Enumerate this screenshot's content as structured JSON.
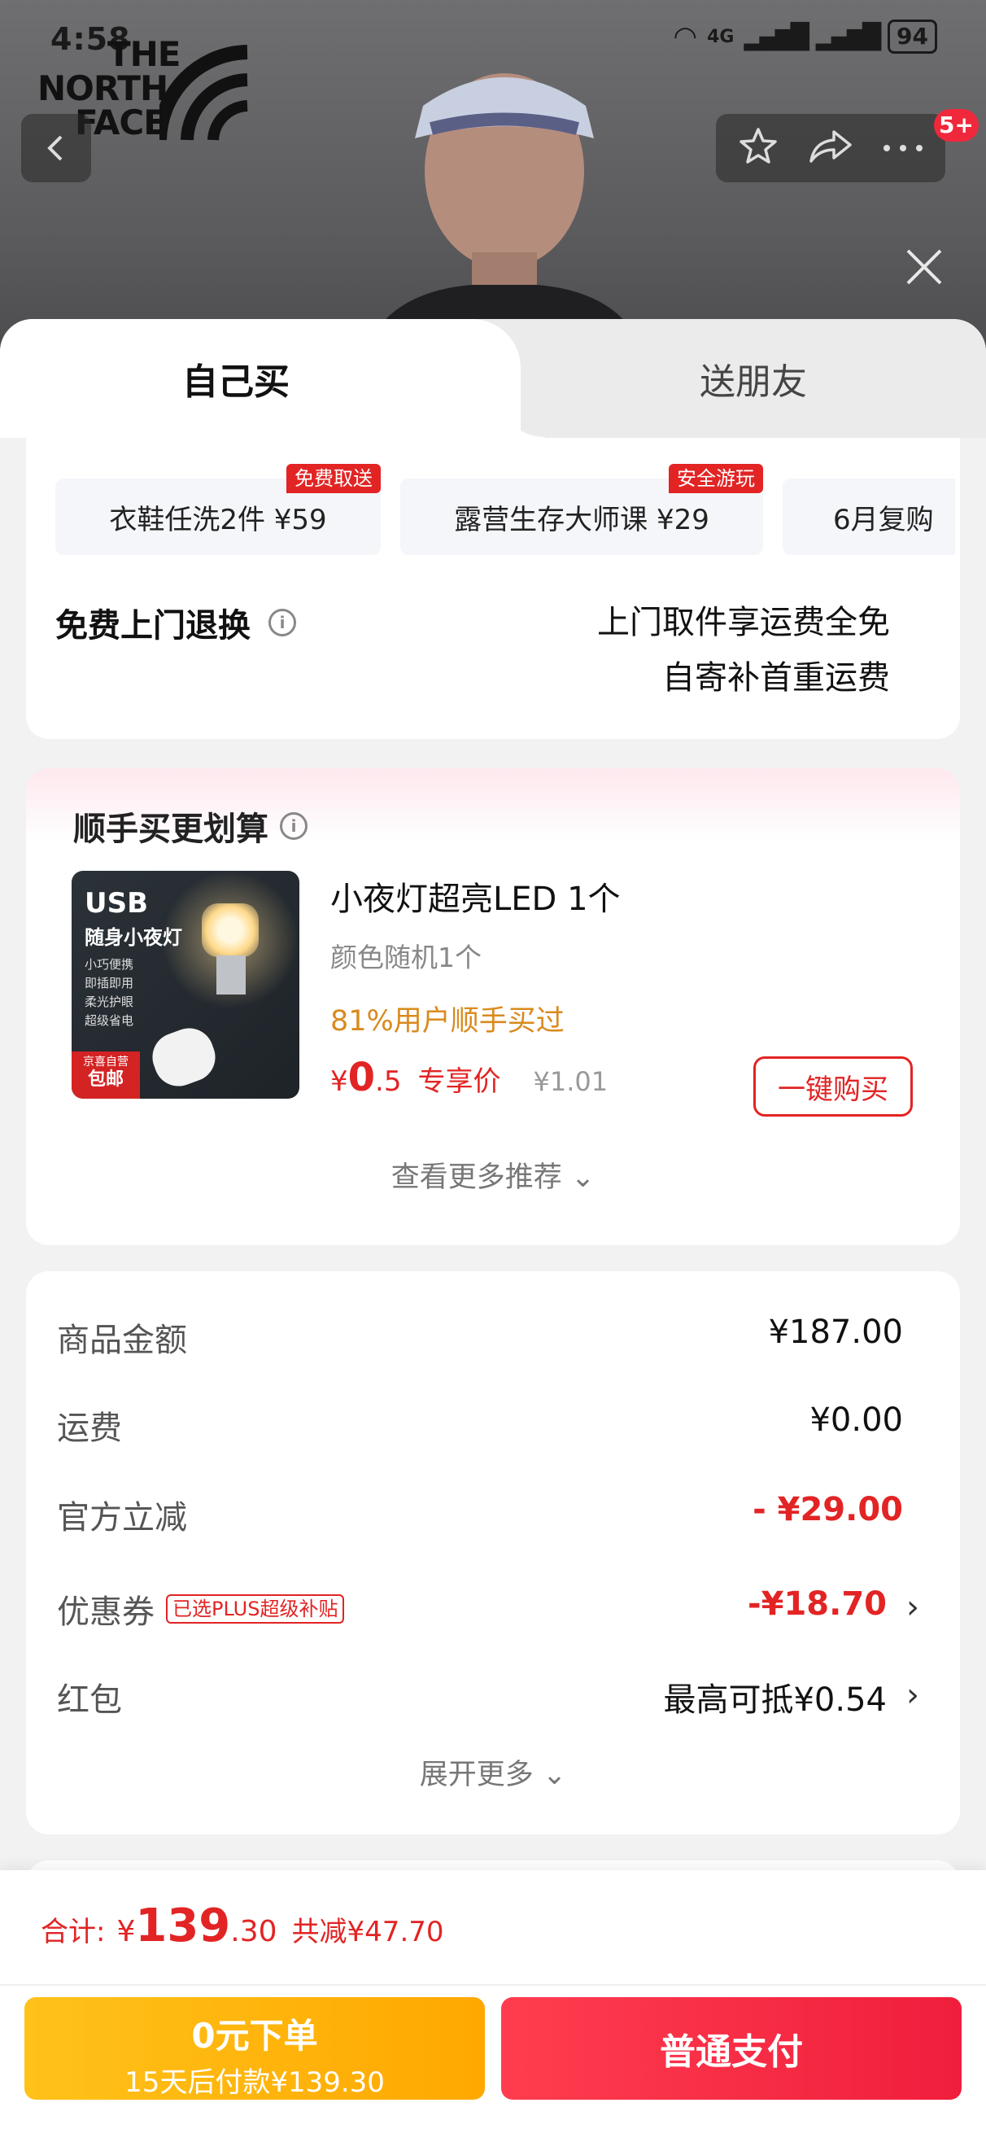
{
  "status": {
    "time": "4:58",
    "battery": "94",
    "net": "4G"
  },
  "brand": {
    "logo_line1": "THE",
    "logo_line2": "NORTH",
    "logo_line3": "FACE"
  },
  "topbar": {
    "badge": "5+"
  },
  "tabs": {
    "self": "自己买",
    "friend": "送朋友"
  },
  "services": [
    {
      "label": "衣鞋任洗2件 ¥59",
      "tag": "免费取送"
    },
    {
      "label": "露营生存大师课 ¥29",
      "tag": "安全游玩"
    },
    {
      "label": "6月复购",
      "tag": ""
    }
  ],
  "returns": {
    "title": "免费上门退换",
    "line1": "上门取件享运费全免",
    "line2": "自寄补首重运费"
  },
  "addon": {
    "title": "顺手买更划算",
    "image_text": {
      "usb": "USB",
      "sub": "随身小夜灯",
      "features": [
        "小巧便携",
        "即插即用",
        "柔光护眼",
        "超级省电"
      ],
      "tag_top": "京喜自营",
      "tag_bottom": "包邮"
    },
    "name": "小夜灯超亮LED 1个",
    "spec": "颜色随机1个",
    "bought": "81%用户顺手买过",
    "price_currency": "¥",
    "price_int": "0",
    "price_dec": ".5",
    "price_label": "专享价",
    "orig_price": "¥1.01",
    "buy_label": "一键购买",
    "more_label": "查看更多推荐"
  },
  "summary": {
    "rows": [
      {
        "label": "商品金额",
        "value": "¥187.00"
      },
      {
        "label": "运费",
        "value": "¥0.00"
      },
      {
        "label": "官方立减",
        "value": "- ¥29.00"
      },
      {
        "label": "优惠券",
        "tag": "已选PLUS超级补贴",
        "value": "-¥18.70"
      },
      {
        "label": "红包",
        "value": "最高可抵¥0.54"
      }
    ],
    "expand_label": "展开更多"
  },
  "footer": {
    "total_label": "合计:",
    "total_currency": "¥",
    "total_int": "139",
    "total_dec": ".30",
    "total_save": "共减¥47.70",
    "pay_later_line1": "0元下单",
    "pay_later_line2": "15天后付款¥139.30",
    "pay_normal": "普通支付"
  },
  "colors": {
    "accent_red": "#e22424",
    "pay_later": "#ffb300",
    "pay_normal": "#f0283c",
    "bought_text": "#d98a1e"
  }
}
